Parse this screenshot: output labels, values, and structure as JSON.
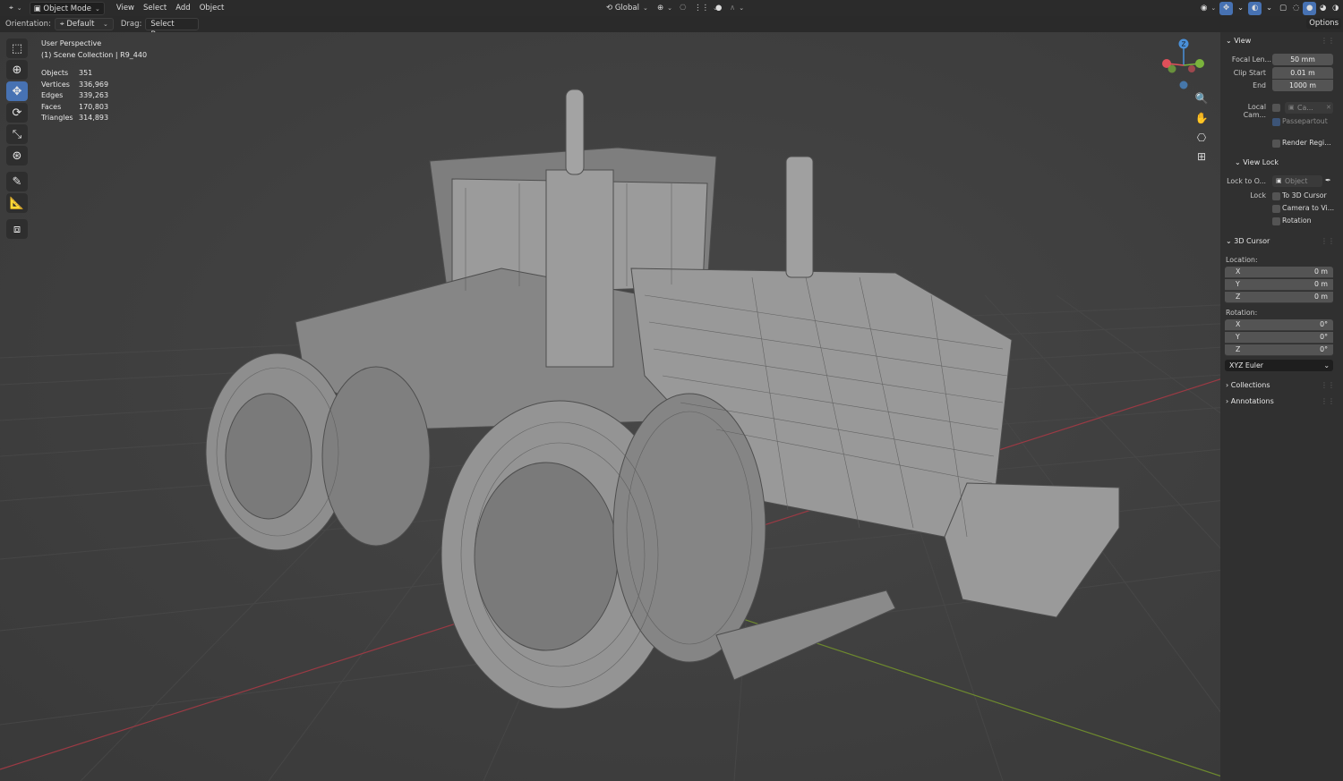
{
  "header": {
    "mode": "Object Mode",
    "menus": [
      "View",
      "Select",
      "Add",
      "Object"
    ],
    "transform_orientation": "Global"
  },
  "toolbar2": {
    "orientation_label": "Orientation:",
    "orientation_value": "Default",
    "drag_label": "Drag:",
    "drag_value": "Select Box"
  },
  "overlay": {
    "view_name": "User Perspective",
    "collection": "(1) Scene Collection | R9_440",
    "stats": [
      {
        "label": "Objects",
        "value": "351"
      },
      {
        "label": "Vertices",
        "value": "336,969"
      },
      {
        "label": "Edges",
        "value": "339,263"
      },
      {
        "label": "Faces",
        "value": "170,803"
      },
      {
        "label": "Triangles",
        "value": "314,893"
      }
    ]
  },
  "gizmo": {
    "z_label": "Z",
    "x_color": "#e0505a",
    "y_color": "#7ab33c",
    "z_color": "#4a90d9"
  },
  "npanel": {
    "options_label": "Options",
    "view": {
      "title": "View",
      "focal_label": "Focal Len...",
      "focal_value": "50 mm",
      "clip_start_label": "Clip Start",
      "clip_start_value": "0.01 m",
      "end_label": "End",
      "end_value": "1000 m",
      "local_cam_label": "Local Cam...",
      "local_cam_value": "Ca...",
      "passepartout": "Passepartout",
      "render_region": "Render Regi..."
    },
    "view_lock": {
      "title": "View Lock",
      "lock_to_label": "Lock to O...",
      "lock_to_placeholder": "Object",
      "lock_label": "Lock",
      "to_cursor": "To 3D Cursor",
      "camera_to_view": "Camera to Vi...",
      "rotation": "Rotation"
    },
    "cursor": {
      "title": "3D Cursor",
      "location_label": "Location:",
      "location": [
        {
          "axis": "X",
          "value": "0 m"
        },
        {
          "axis": "Y",
          "value": "0 m"
        },
        {
          "axis": "Z",
          "value": "0 m"
        }
      ],
      "rotation_label": "Rotation:",
      "rotation": [
        {
          "axis": "X",
          "value": "0°"
        },
        {
          "axis": "Y",
          "value": "0°"
        },
        {
          "axis": "Z",
          "value": "0°"
        }
      ],
      "rotation_mode": "XYZ Euler"
    },
    "collections": "Collections",
    "annotations": "Annotations"
  }
}
